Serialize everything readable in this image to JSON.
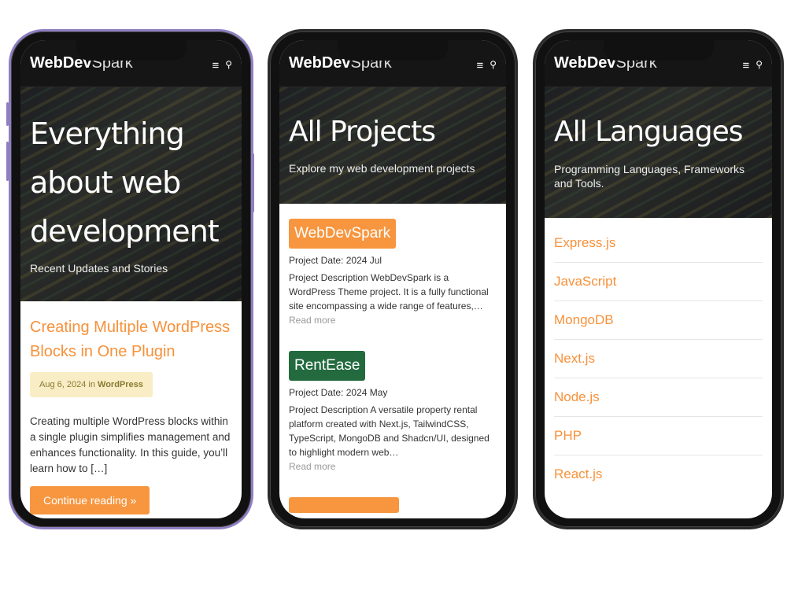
{
  "brand": {
    "bold": "WebDev",
    "light": "Spark"
  },
  "icons": {
    "menu": "≡",
    "search": "🔍"
  },
  "colors": {
    "accent": "#f7963f",
    "green": "#236b3f",
    "meta_bg": "#f8edc5",
    "dark": "#151515"
  },
  "home": {
    "hero_title": "Everything about web development",
    "hero_subtitle": "Recent Updates and Stories",
    "post_title": "Creating Multiple WordPress Blocks in One Plugin",
    "post_date": "Aug 6, 2024",
    "post_in": "in",
    "post_category": "WordPress",
    "excerpt": "Creating multiple WordPress blocks within a single plugin simplifies management and enhances functionality. In this guide, you’ll learn how to […]",
    "continue_label": "Continue reading »"
  },
  "projects": {
    "hero_title": "All Projects",
    "hero_subtitle": "Explore my web development projects",
    "date_label": "Project Date:",
    "read_more": "Read more",
    "items": [
      {
        "name": "WebDevSpark",
        "date": "2024 Jul",
        "description": "Project Description WebDevSpark is a WordPress Theme project. It is a fully functional site encompassing a wide range of features,…"
      },
      {
        "name": "RentEase",
        "date": "2024 May",
        "description": "Project Description A versatile property rental platform created with Next.js, TailwindCSS, TypeScript, MongoDB and Shadcn/UI, designed to highlight modern web…"
      }
    ]
  },
  "languages": {
    "hero_title": "All Languages",
    "hero_subtitle": "Programming Languages, Frameworks and Tools.",
    "items": [
      "Express.js",
      "JavaScript",
      "MongoDB",
      "Next.js",
      "Node.js",
      "PHP",
      "React.js"
    ]
  }
}
